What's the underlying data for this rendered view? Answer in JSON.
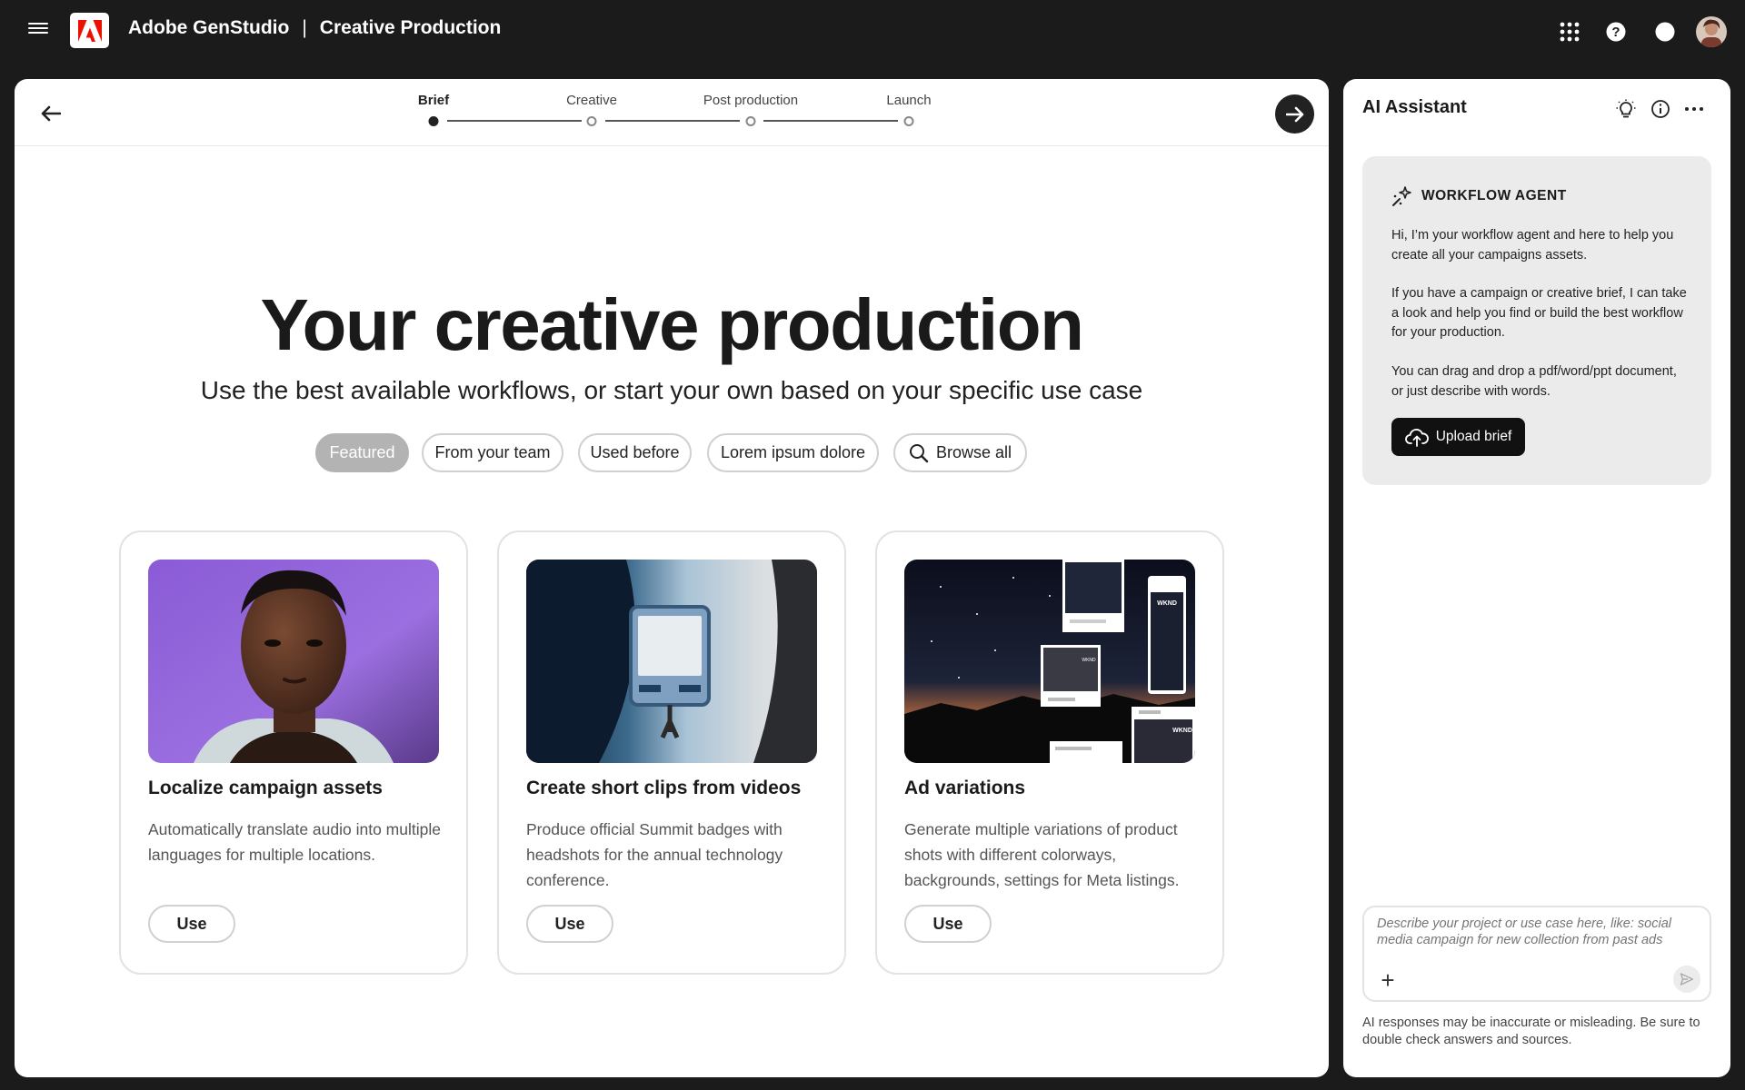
{
  "topbar": {
    "brand": "Adobe GenStudio",
    "separator": "|",
    "section": "Creative Production",
    "icons": [
      "menu-icon",
      "adobe-logo",
      "apps-grid-icon",
      "help-icon",
      "notifications-icon",
      "user-avatar"
    ]
  },
  "stepper": {
    "steps": [
      {
        "label": "Brief",
        "active": true
      },
      {
        "label": "Creative",
        "active": false
      },
      {
        "label": "Post production",
        "active": false
      },
      {
        "label": "Launch",
        "active": false
      }
    ]
  },
  "hero": {
    "title": "Your creative production",
    "subtitle": "Use the best available workflows, or start your own based on your specific use case"
  },
  "filters": [
    {
      "label": "Featured",
      "active": true
    },
    {
      "label": "From your team",
      "active": false
    },
    {
      "label": "Used before",
      "active": false
    },
    {
      "label": "Lorem ipsum dolore",
      "active": false
    },
    {
      "label": "Browse all",
      "active": false,
      "icon": "search-icon"
    }
  ],
  "cards": [
    {
      "title": "Localize campaign assets",
      "description": "Automatically translate audio into multiple languages for multiple locations.",
      "button": "Use",
      "image": "portrait-photo"
    },
    {
      "title": "Create short clips from videos",
      "description": "Produce official Summit badges with headshots for the annual technology conference.",
      "button": "Use",
      "image": "badge-photo"
    },
    {
      "title": "Ad variations",
      "description": "Generate multiple variations of product shots with different colorways, backgrounds, settings for Meta listings.",
      "button": "Use",
      "image": "night-sky-ad-mockups",
      "image_text": [
        "WKND",
        "WKND",
        "WKND"
      ]
    }
  ],
  "assistant": {
    "title": "AI Assistant",
    "agent": {
      "label": "WORKFLOW AGENT",
      "paragraphs": [
        "Hi, I’m your workflow agent and here to help you create all your campaigns assets.",
        "If you have a campaign or creative brief, I can take a look and help you find or build the best workflow for your production.",
        "You can drag and drop a pdf/word/ppt document, or just describe with words."
      ],
      "upload_label": "Upload brief"
    },
    "prompt_placeholder": "Describe your project or use case here, like: social media campaign for new collection from past ads",
    "disclaimer": "AI responses may be inaccurate or misleading. Be sure to double check answers and sources."
  },
  "colors": {
    "background": "#1b1b1b",
    "adobe_red": "#eb1000",
    "chip_active": "#b3b3b3",
    "agent_card": "#ebebeb"
  }
}
